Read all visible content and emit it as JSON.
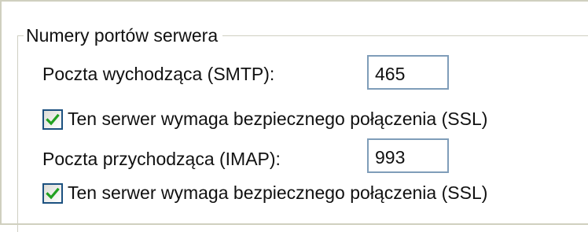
{
  "group": {
    "title": "Numery portów serwera"
  },
  "smtp": {
    "label": "Poczta wychodząca (SMTP):",
    "port": "465",
    "ssl_label": "Ten serwer wymaga bezpiecznego połączenia (SSL)",
    "ssl_checked": true
  },
  "imap": {
    "label": "Poczta przychodząca (IMAP):",
    "port": "993",
    "ssl_label": "Ten serwer wymaga bezpiecznego połączenia (SSL)",
    "ssl_checked": true
  },
  "colors": {
    "checkmark": "#21a121",
    "checkbox_border": "#1c5180",
    "input_border": "#7f9db9"
  },
  "icons": {
    "checkbox_checked": "checkmark-icon"
  }
}
